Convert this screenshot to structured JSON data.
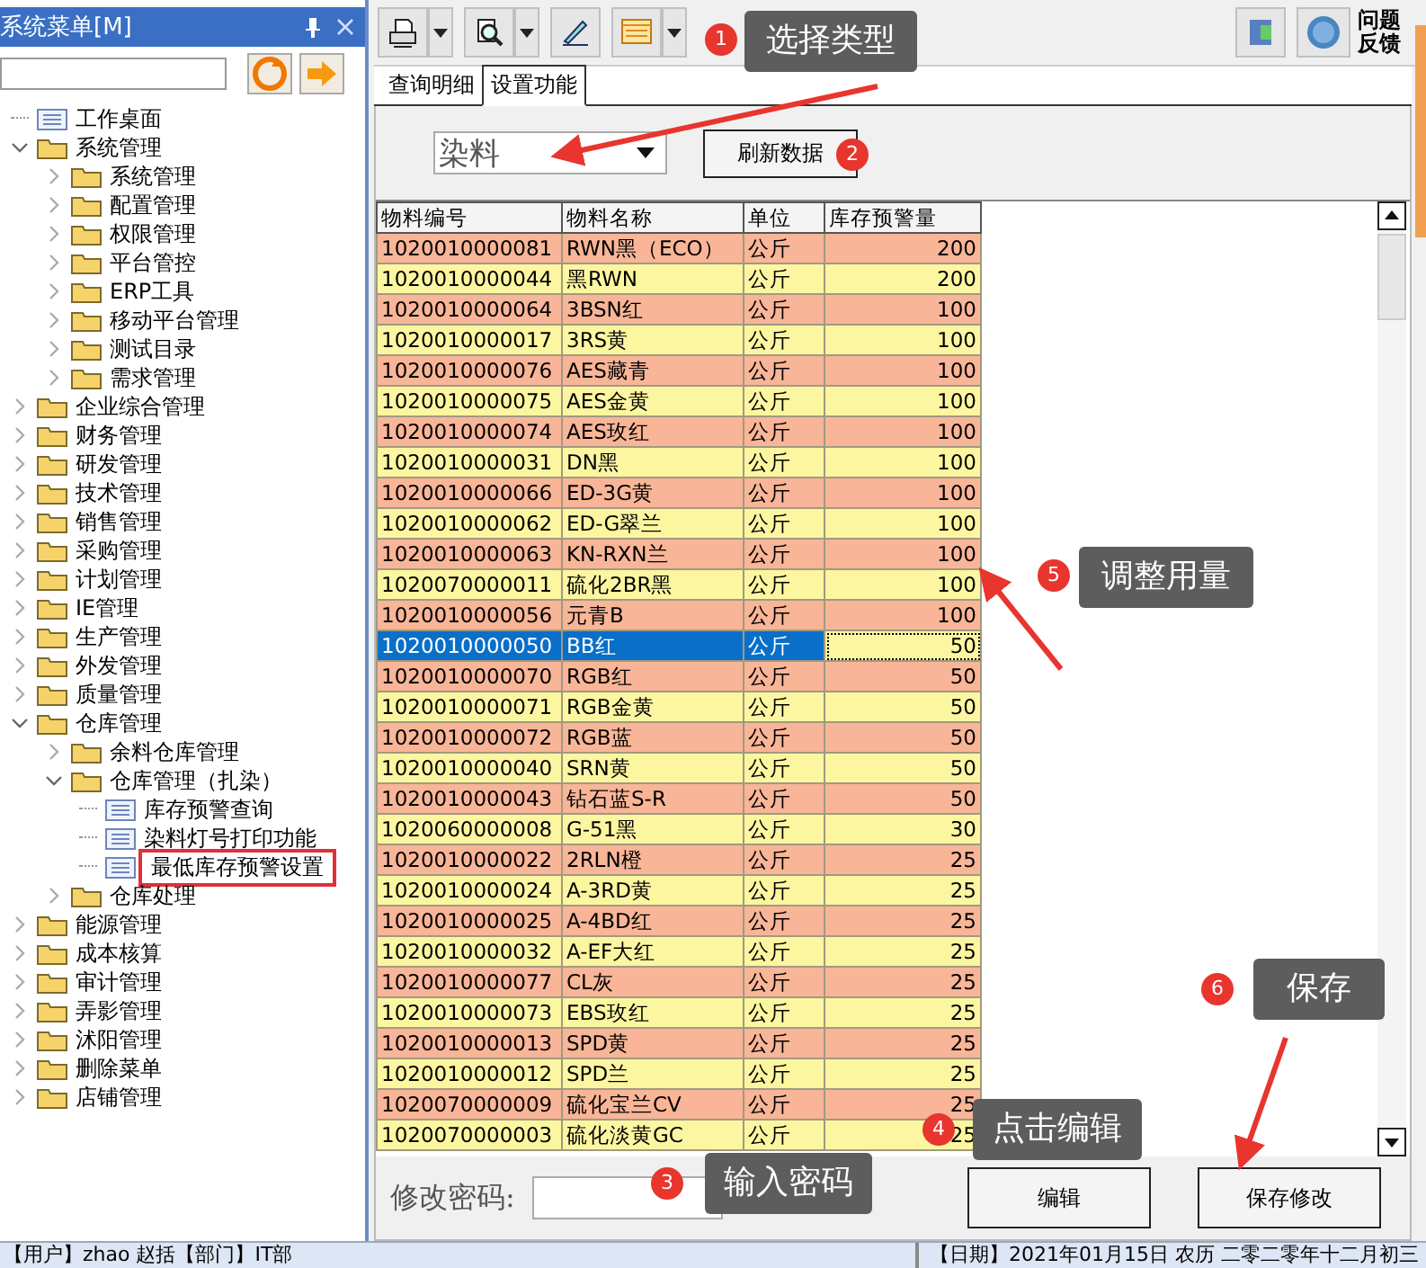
{
  "sidebar": {
    "title": "系统菜单[M]",
    "tree": [
      {
        "label": "工作桌面",
        "kind": "page",
        "boxed": false
      },
      {
        "label": "系统管理",
        "kind": "folder",
        "expanded": true,
        "boxed": false,
        "children": [
          {
            "label": "系统管理",
            "kind": "folder",
            "expanded": false,
            "boxed": false
          },
          {
            "label": "配置管理",
            "kind": "folder",
            "expanded": false,
            "boxed": false
          },
          {
            "label": "权限管理",
            "kind": "folder",
            "expanded": false,
            "boxed": false
          },
          {
            "label": "平台管控",
            "kind": "folder",
            "expanded": false,
            "boxed": false
          },
          {
            "label": "ERP工具",
            "kind": "folder",
            "expanded": false,
            "boxed": false
          },
          {
            "label": "移动平台管理",
            "kind": "folder",
            "expanded": false,
            "boxed": false
          },
          {
            "label": "测试目录",
            "kind": "folder",
            "expanded": false,
            "boxed": false
          },
          {
            "label": "需求管理",
            "kind": "folder",
            "expanded": false,
            "boxed": false
          }
        ]
      },
      {
        "label": "企业综合管理",
        "kind": "folder",
        "expanded": false,
        "boxed": false
      },
      {
        "label": "财务管理",
        "kind": "folder",
        "expanded": false,
        "boxed": false
      },
      {
        "label": "研发管理",
        "kind": "folder",
        "expanded": false,
        "boxed": false
      },
      {
        "label": "技术管理",
        "kind": "folder",
        "expanded": false,
        "boxed": false
      },
      {
        "label": "销售管理",
        "kind": "folder",
        "expanded": false,
        "boxed": false
      },
      {
        "label": "采购管理",
        "kind": "folder",
        "expanded": false,
        "boxed": false
      },
      {
        "label": "计划管理",
        "kind": "folder",
        "expanded": false,
        "boxed": false
      },
      {
        "label": "IE管理",
        "kind": "folder",
        "expanded": false,
        "boxed": false
      },
      {
        "label": "生产管理",
        "kind": "folder",
        "expanded": false,
        "boxed": false
      },
      {
        "label": "外发管理",
        "kind": "folder",
        "expanded": false,
        "boxed": false
      },
      {
        "label": "质量管理",
        "kind": "folder",
        "expanded": false,
        "boxed": false
      },
      {
        "label": "仓库管理",
        "kind": "folder",
        "expanded": true,
        "boxed": false,
        "children": [
          {
            "label": "余料仓库管理",
            "kind": "folder",
            "expanded": false,
            "boxed": false
          },
          {
            "label": "仓库管理（扎染）",
            "kind": "folder",
            "expanded": true,
            "boxed": false,
            "children": [
              {
                "label": "库存预警查询",
                "kind": "page",
                "boxed": false
              },
              {
                "label": "染料灯号打印功能",
                "kind": "page",
                "boxed": false
              },
              {
                "label": "最低库存预警设置",
                "kind": "page",
                "boxed": true
              }
            ]
          },
          {
            "label": "仓库处理",
            "kind": "folder",
            "expanded": false,
            "boxed": false
          }
        ]
      },
      {
        "label": "能源管理",
        "kind": "folder",
        "expanded": false,
        "boxed": false
      },
      {
        "label": "成本核算",
        "kind": "folder",
        "expanded": false,
        "boxed": false
      },
      {
        "label": "审计管理",
        "kind": "folder",
        "expanded": false,
        "boxed": false
      },
      {
        "label": "弄影管理",
        "kind": "folder",
        "expanded": false,
        "boxed": false
      },
      {
        "label": "沭阳管理",
        "kind": "folder",
        "expanded": false,
        "boxed": false
      },
      {
        "label": "删除菜单",
        "kind": "folder",
        "expanded": false,
        "boxed": false
      },
      {
        "label": "店铺管理",
        "kind": "folder",
        "expanded": false,
        "boxed": false
      }
    ]
  },
  "toolbar": {
    "feedback_label": "问题反馈"
  },
  "tabs": [
    {
      "label": "查询明细",
      "selected": false
    },
    {
      "label": "设置功能",
      "selected": true
    }
  ],
  "filter": {
    "type_value": "染料",
    "refresh_button": "刷新数据"
  },
  "table": {
    "columns": [
      "物料编号",
      "物料名称",
      "单位",
      "库存预警量"
    ],
    "rows": [
      {
        "cells": [
          "1020010000081",
          "RWN黑（ECO）",
          "公斤",
          "200"
        ],
        "selected": false
      },
      {
        "cells": [
          "1020010000044",
          "黑RWN",
          "公斤",
          "200"
        ],
        "selected": false
      },
      {
        "cells": [
          "1020010000064",
          "3BSN红",
          "公斤",
          "100"
        ],
        "selected": false
      },
      {
        "cells": [
          "1020010000017",
          "3RS黄",
          "公斤",
          "100"
        ],
        "selected": false
      },
      {
        "cells": [
          "1020010000076",
          "AES藏青",
          "公斤",
          "100"
        ],
        "selected": false
      },
      {
        "cells": [
          "1020010000075",
          "AES金黄",
          "公斤",
          "100"
        ],
        "selected": false
      },
      {
        "cells": [
          "1020010000074",
          "AES玫红",
          "公斤",
          "100"
        ],
        "selected": false
      },
      {
        "cells": [
          "1020010000031",
          "DN黑",
          "公斤",
          "100"
        ],
        "selected": false
      },
      {
        "cells": [
          "1020010000066",
          "ED-3G黄",
          "公斤",
          "100"
        ],
        "selected": false
      },
      {
        "cells": [
          "1020010000062",
          "ED-G翠兰",
          "公斤",
          "100"
        ],
        "selected": false
      },
      {
        "cells": [
          "1020010000063",
          "KN-RXN兰",
          "公斤",
          "100"
        ],
        "selected": false
      },
      {
        "cells": [
          "1020070000011",
          "硫化2BR黑",
          "公斤",
          "100"
        ],
        "selected": false
      },
      {
        "cells": [
          "1020010000056",
          "元青B",
          "公斤",
          "100"
        ],
        "selected": false
      },
      {
        "cells": [
          "1020010000050",
          "BB红",
          "公斤",
          "50"
        ],
        "selected": true
      },
      {
        "cells": [
          "1020010000070",
          "RGB红",
          "公斤",
          "50"
        ],
        "selected": false
      },
      {
        "cells": [
          "1020010000071",
          "RGB金黄",
          "公斤",
          "50"
        ],
        "selected": false
      },
      {
        "cells": [
          "1020010000072",
          "RGB蓝",
          "公斤",
          "50"
        ],
        "selected": false
      },
      {
        "cells": [
          "1020010000040",
          "SRN黄",
          "公斤",
          "50"
        ],
        "selected": false
      },
      {
        "cells": [
          "1020010000043",
          "钻石蓝S-R",
          "公斤",
          "50"
        ],
        "selected": false
      },
      {
        "cells": [
          "1020060000008",
          "G-51黑",
          "公斤",
          "30"
        ],
        "selected": false
      },
      {
        "cells": [
          "1020010000022",
          "2RLN橙",
          "公斤",
          "25"
        ],
        "selected": false
      },
      {
        "cells": [
          "1020010000024",
          "A-3RD黄",
          "公斤",
          "25"
        ],
        "selected": false
      },
      {
        "cells": [
          "1020010000025",
          "A-4BD红",
          "公斤",
          "25"
        ],
        "selected": false
      },
      {
        "cells": [
          "1020010000032",
          "A-EF大红",
          "公斤",
          "25"
        ],
        "selected": false
      },
      {
        "cells": [
          "1020010000077",
          "CL灰",
          "公斤",
          "25"
        ],
        "selected": false
      },
      {
        "cells": [
          "1020010000073",
          "EBS玫红",
          "公斤",
          "25"
        ],
        "selected": false
      },
      {
        "cells": [
          "1020010000013",
          "SPD黄",
          "公斤",
          "25"
        ],
        "selected": false
      },
      {
        "cells": [
          "1020010000012",
          "SPD兰",
          "公斤",
          "25"
        ],
        "selected": false
      },
      {
        "cells": [
          "1020070000009",
          "硫化宝兰CV",
          "公斤",
          "25"
        ],
        "selected": false
      },
      {
        "cells": [
          "1020070000003",
          "硫化淡黄GC",
          "公斤",
          "25"
        ],
        "selected": false
      }
    ]
  },
  "footer": {
    "password_label": "修改密码:",
    "edit_button": "编辑",
    "save_button": "保存修改"
  },
  "annotations": [
    {
      "number": "1",
      "text": "选择类型"
    },
    {
      "number": "2"
    },
    {
      "number": "3",
      "text": "输入密码"
    },
    {
      "number": "4",
      "text": "点击编辑"
    },
    {
      "number": "5",
      "text": "调整用量"
    },
    {
      "number": "6",
      "text": "保存"
    }
  ],
  "status_bar": {
    "left": "【用户】zhao 赵括【部门】IT部",
    "right": "【日期】2021年01月15日 农历 二零二零年十二月初三"
  }
}
